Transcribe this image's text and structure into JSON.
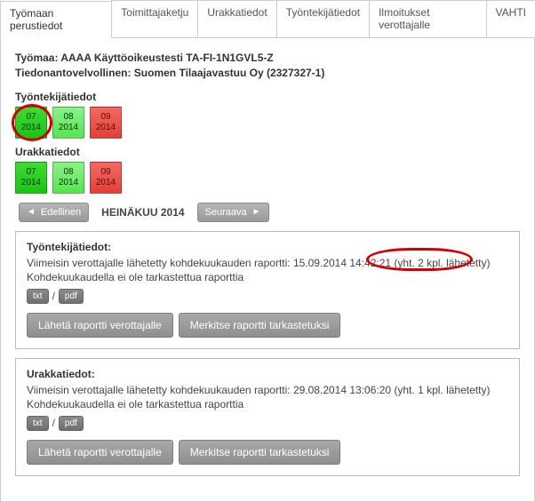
{
  "tabs": [
    {
      "label": "Työmaan perustiedot",
      "active": true
    },
    {
      "label": "Toimittajaketju",
      "active": false
    },
    {
      "label": "Urakkatiedot",
      "active": false
    },
    {
      "label": "Työntekijätiedot",
      "active": false
    },
    {
      "label": "Ilmoitukset verottajalle",
      "active": false
    },
    {
      "label": "VAHTI",
      "active": false
    }
  ],
  "header": {
    "line1": "Työmaa: AAAA Käyttöoikeustesti TA-FI-1N1GVL5-Z",
    "line2": "Tiedonantovelvollinen: Suomen Tilaajavastuu Oy (2327327-1)"
  },
  "sections": {
    "worker": {
      "label": "Työntekijätiedot",
      "tiles": [
        {
          "month": "07",
          "year": "2014",
          "style": "green"
        },
        {
          "month": "08",
          "year": "2014",
          "style": "greenL"
        },
        {
          "month": "09",
          "year": "2014",
          "style": "red"
        }
      ]
    },
    "contract": {
      "label": "Urakkatiedot",
      "tiles": [
        {
          "month": "07",
          "year": "2014",
          "style": "green"
        },
        {
          "month": "08",
          "year": "2014",
          "style": "greenL"
        },
        {
          "month": "09",
          "year": "2014",
          "style": "red"
        }
      ]
    }
  },
  "nav": {
    "prev": "Edellinen",
    "month": "HEINÄKUU 2014",
    "next": "Seuraava"
  },
  "boxes": [
    {
      "title": "Työntekijätiedot:",
      "line_pre": "Viimeisin verottajalle lähetetty kohdekuukauden raportti: 15.09.2014 14:42:21 (",
      "line_hl": "yht. 2 kpl. lähetetty",
      "line_post": ")",
      "line2": "Kohdekuukaudella ei ole tarkastettua raporttia",
      "fmt1": "txt",
      "fmt2": "pdf",
      "btn1": "Lähetä raportti verottajalle",
      "btn2": "Merkitse raportti tarkastetuksi",
      "highlight": true
    },
    {
      "title": "Urakkatiedot:",
      "line_pre": "Viimeisin verottajalle lähetetty kohdekuukauden raportti: 29.08.2014 13:06:20 (yht. 1 kpl. lähetetty)",
      "line_hl": "",
      "line_post": "",
      "line2": "Kohdekuukaudella ei ole tarkastettua raporttia",
      "fmt1": "txt",
      "fmt2": "pdf",
      "btn1": "Lähetä raportti verottajalle",
      "btn2": "Merkitse raportti tarkastetuksi",
      "highlight": false
    }
  ]
}
